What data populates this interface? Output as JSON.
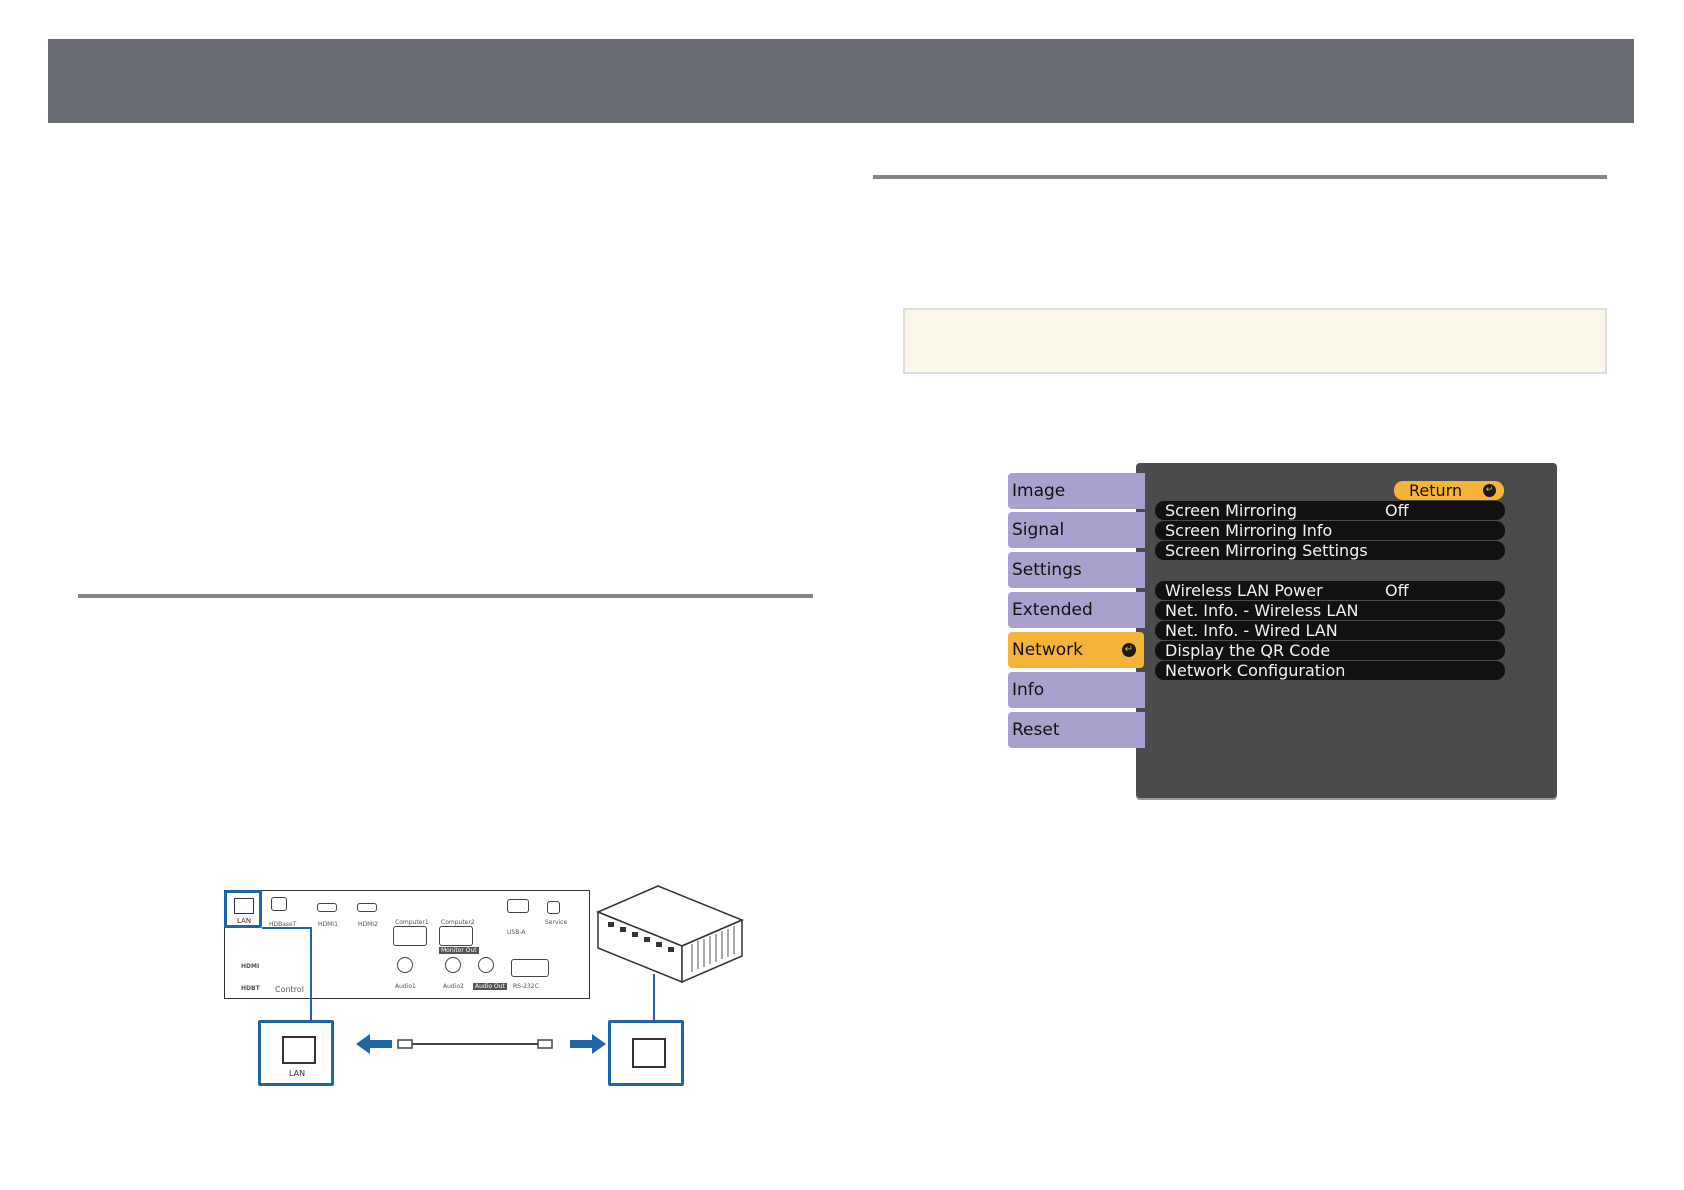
{
  "menu": {
    "tabs": [
      {
        "label": "Image",
        "active": false
      },
      {
        "label": "Signal",
        "active": false
      },
      {
        "label": "Settings",
        "active": false
      },
      {
        "label": "Extended",
        "active": false
      },
      {
        "label": "Network",
        "active": true
      },
      {
        "label": "Info",
        "active": false
      },
      {
        "label": "Reset",
        "active": false
      }
    ],
    "return_label": "Return",
    "items": [
      {
        "label": "Screen Mirroring",
        "value": "Off"
      },
      {
        "label": "Screen Mirroring Info",
        "value": ""
      },
      {
        "label": "Screen Mirroring Settings",
        "value": ""
      },
      {
        "label": "Wireless LAN Power",
        "value": "Off"
      },
      {
        "label": "Net. Info. - Wireless LAN",
        "value": ""
      },
      {
        "label": "Net. Info. - Wired LAN",
        "value": ""
      },
      {
        "label": "Display the QR Code",
        "value": ""
      },
      {
        "label": "Network Configuration",
        "value": ""
      }
    ]
  },
  "diagram": {
    "port_labels": {
      "lan": "LAN",
      "hdbaset": "HDBaseT",
      "hdmi1": "HDMI1",
      "hdmi2": "HDMI2",
      "computer1": "Computer1",
      "computer2": "Computer2",
      "monitor_out": "Monitor Out",
      "usb_a": "USB-A",
      "service": "Service",
      "audio1": "Audio1",
      "audio2": "Audio2",
      "audio_out": "Audio Out",
      "rs232c": "RS-232C",
      "hdmi_logo": "HDMI",
      "hdbaset_logo": "HDBT",
      "control_logo": "Control"
    },
    "callout_label": "LAN"
  }
}
